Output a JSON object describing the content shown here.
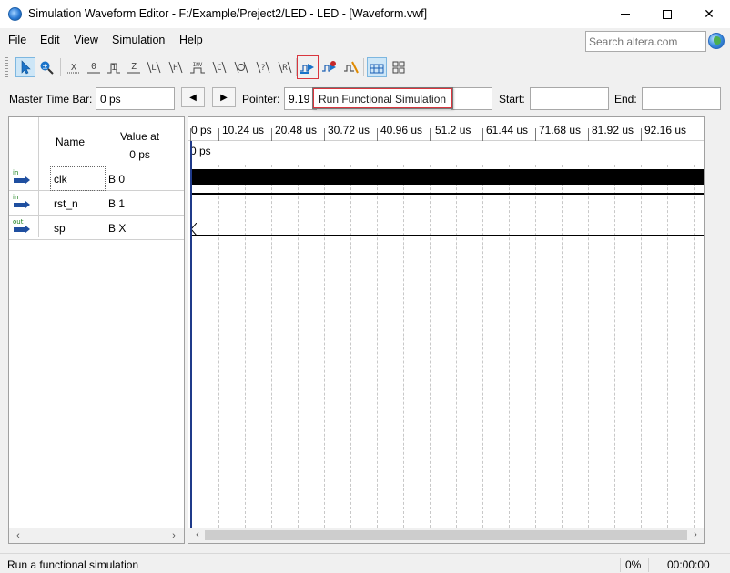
{
  "window": {
    "title": "Simulation Waveform Editor - F:/Example/Preject2/LED - LED - [Waveform.vwf]",
    "minimize": "—",
    "maximize": "□",
    "close": "✕"
  },
  "menu": {
    "items": [
      {
        "hot": "F",
        "rest": "ile"
      },
      {
        "hot": "E",
        "rest": "dit"
      },
      {
        "hot": "V",
        "rest": "iew"
      },
      {
        "hot": "S",
        "rest": "imulation"
      },
      {
        "hot": "H",
        "rest": "elp"
      }
    ],
    "search_placeholder": "Search altera.com"
  },
  "toolbar": {
    "tooltip": "Run Functional Simulation",
    "buttons": [
      {
        "name": "selection-tool-icon",
        "glyph": "↖"
      },
      {
        "name": "zoom-tool-icon",
        "glyph": "🔍"
      },
      {
        "name": "force-unknown-icon",
        "glyph": "X̲"
      },
      {
        "name": "force-low-icon",
        "glyph": "0̲"
      },
      {
        "name": "force-high-icon",
        "glyph": "1̲"
      },
      {
        "name": "force-high-impedance-icon",
        "glyph": "Z̲"
      },
      {
        "name": "force-weak-low-icon",
        "glyph": "L̲"
      },
      {
        "name": "force-weak-high-icon",
        "glyph": "H̲"
      },
      {
        "name": "invert-icon",
        "glyph": "INV"
      },
      {
        "name": "count-value-icon",
        "glyph": "C̲"
      },
      {
        "name": "clock-value-icon",
        "glyph": "⊙"
      },
      {
        "name": "random-value-icon",
        "glyph": "?̲"
      },
      {
        "name": "arbitrary-value-icon",
        "glyph": "R̲"
      },
      {
        "name": "run-functional-simulation-icon",
        "glyph": "▶"
      },
      {
        "name": "run-timing-simulation-icon",
        "glyph": "⏱"
      },
      {
        "name": "run-timing-netlist-icon",
        "glyph": "⚡"
      },
      {
        "name": "snap-to-grid-icon",
        "glyph": "▦"
      },
      {
        "name": "grid-settings-icon",
        "glyph": "⊞"
      }
    ]
  },
  "timebar": {
    "master_label": "Master Time Bar:",
    "master_value": "0 ps",
    "prev": "◀",
    "next": "▶",
    "pointer_label": "Pointer:",
    "pointer_value": "9.19",
    "interval_value": "",
    "start_label": "Start:",
    "start_value": "",
    "end_label": "End:",
    "end_value": ""
  },
  "signals": {
    "name_header": "Name",
    "value_header_line1": "Value at",
    "value_header_line2": "0 ps",
    "rows": [
      {
        "dir": "in",
        "name": "clk",
        "value": "B 0"
      },
      {
        "dir": "in",
        "name": "rst_n",
        "value": "B 1"
      },
      {
        "dir": "out",
        "name": "sp",
        "value": "B X"
      }
    ]
  },
  "waveform": {
    "ruler_labels": [
      "0 ps",
      "10.24 us",
      "20.48 us",
      "30.72 us",
      "40.96 us",
      "51.2 us",
      "61.44 us",
      "71.68 us",
      "81.92 us",
      "92.16 us"
    ],
    "marker_label": "0 ps"
  },
  "scroll": {
    "left": "‹",
    "right": "›"
  },
  "status": {
    "message": "Run a functional simulation",
    "progress": "0%",
    "elapsed": "00:00:00"
  },
  "colors": {
    "highlight": "#d9363e",
    "cursor": "#1f3a8a",
    "input_icon": "#1f4fa0"
  }
}
